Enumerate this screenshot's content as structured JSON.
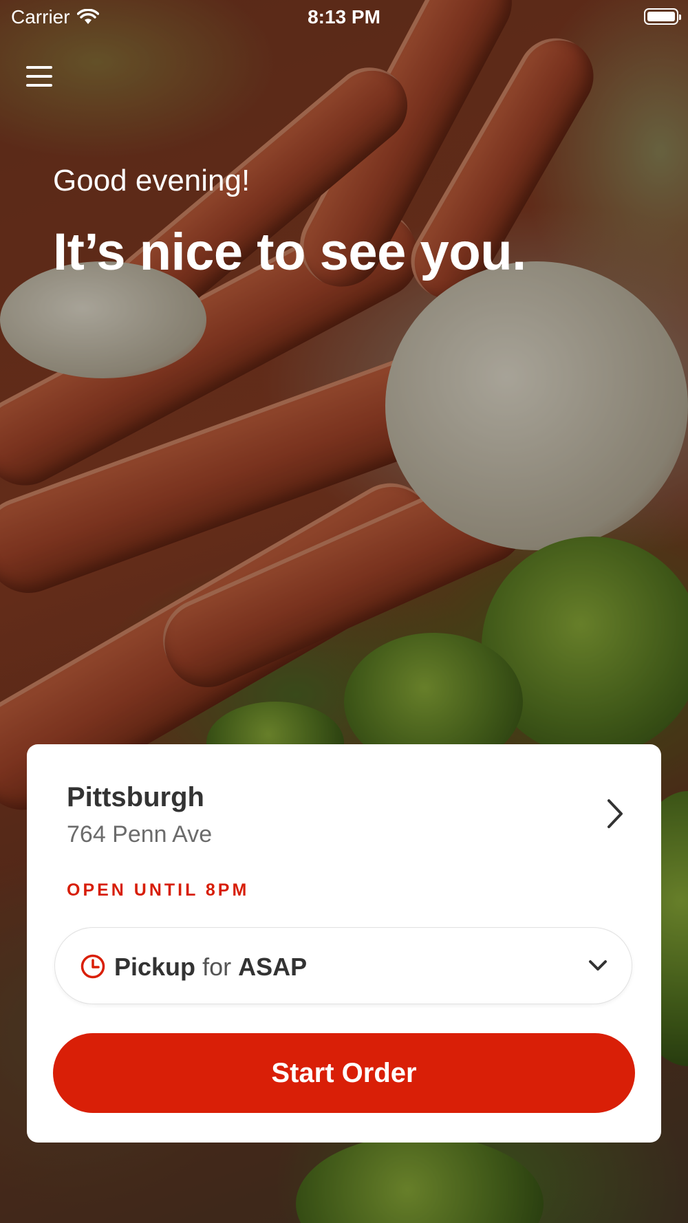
{
  "status_bar": {
    "carrier": "Carrier",
    "time": "8:13 PM",
    "wifi_icon": "wifi-icon",
    "battery_icon": "battery-icon"
  },
  "header": {
    "menu_icon": "hamburger-menu-icon",
    "greeting": "Good evening!",
    "headline": "It’s nice to see you."
  },
  "location_card": {
    "name": "Pittsburgh",
    "address": "764 Penn Ave",
    "status": "OPEN UNTIL 8PM",
    "chevron_icon": "chevron-right-icon",
    "order_mode": {
      "icon": "clock-icon",
      "mode": "Pickup",
      "connector": "for",
      "time": "ASAP",
      "dropdown_icon": "chevron-down-icon"
    },
    "start_button": "Start Order"
  },
  "colors": {
    "accent": "#D91F07",
    "text_dark": "#333333",
    "text_muted": "#6B6B6B",
    "card_bg": "#FFFFFF"
  }
}
